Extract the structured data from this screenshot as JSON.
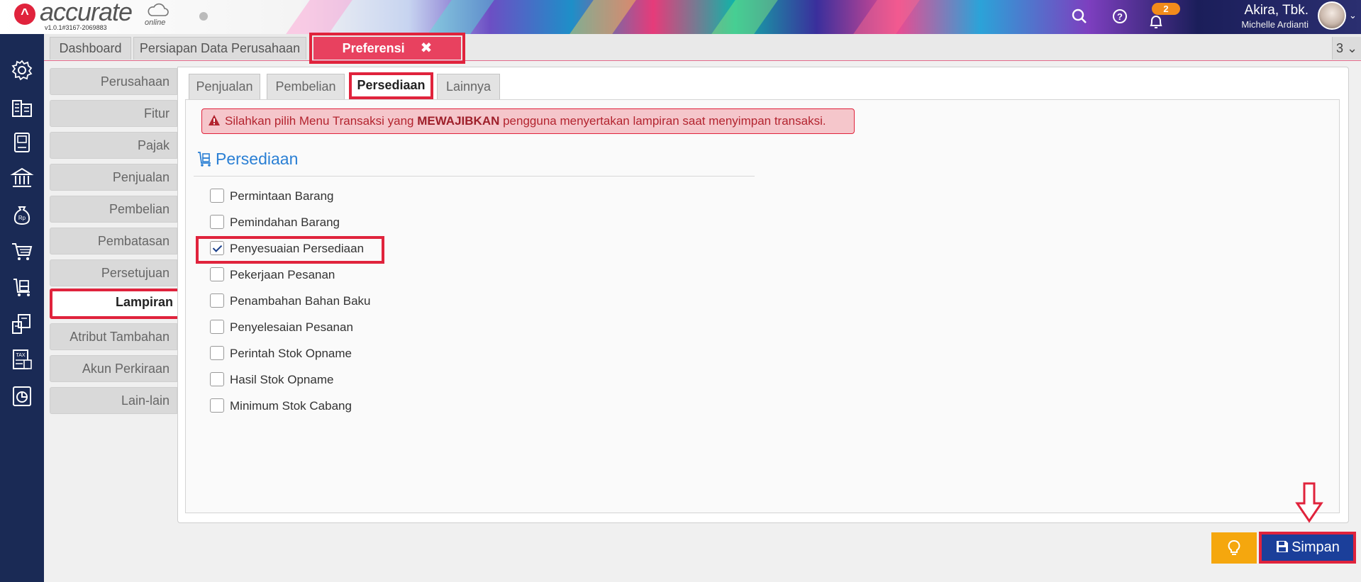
{
  "header": {
    "logo_text": "accurate",
    "logo_sub": "online",
    "version": "v1.0.1#3167-2069883",
    "notification_count": "2",
    "user_company": "Akira, Tbk.",
    "user_name": "Michelle Ardianti"
  },
  "tabs": [
    {
      "label": "Dashboard"
    },
    {
      "label": "Persiapan Data Perusahaan"
    },
    {
      "label": "Preferensi",
      "close": "✖"
    }
  ],
  "tab_overflow": "3 ⌄",
  "pref_menu": [
    {
      "label": "Perusahaan"
    },
    {
      "label": "Fitur"
    },
    {
      "label": "Pajak"
    },
    {
      "label": "Penjualan"
    },
    {
      "label": "Pembelian"
    },
    {
      "label": "Pembatasan"
    },
    {
      "label": "Persetujuan"
    },
    {
      "label": "Lampiran"
    },
    {
      "label": "Atribut Tambahan"
    },
    {
      "label": "Akun Perkiraan"
    },
    {
      "label": "Lain-lain"
    }
  ],
  "subtabs": [
    {
      "label": "Penjualan"
    },
    {
      "label": "Pembelian"
    },
    {
      "label": "Persediaan"
    },
    {
      "label": "Lainnya"
    }
  ],
  "alert": {
    "before": "Silahkan pilih Menu Transaksi yang ",
    "bold": "MEWAJIBKAN",
    "after": " pengguna menyertakan lampiran saat menyimpan transaksi."
  },
  "section_title": "Persediaan",
  "checkboxes": [
    {
      "label": "Permintaan Barang",
      "checked": false
    },
    {
      "label": "Pemindahan Barang",
      "checked": false
    },
    {
      "label": "Penyesuaian Persediaan",
      "checked": true
    },
    {
      "label": "Pekerjaan Pesanan",
      "checked": false
    },
    {
      "label": "Penambahan Bahan Baku",
      "checked": false
    },
    {
      "label": "Penyelesaian Pesanan",
      "checked": false
    },
    {
      "label": "Perintah Stok Opname",
      "checked": false
    },
    {
      "label": "Hasil Stok Opname",
      "checked": false
    },
    {
      "label": "Minimum Stok Cabang",
      "checked": false
    }
  ],
  "buttons": {
    "save_label": "Simpan"
  },
  "colors": {
    "accent_red": "#e0233c",
    "nav_bg": "#1a2a55",
    "save_bg": "#1b3f9a",
    "tip_bg": "#f5a70e",
    "title_blue": "#2a7fd4"
  }
}
